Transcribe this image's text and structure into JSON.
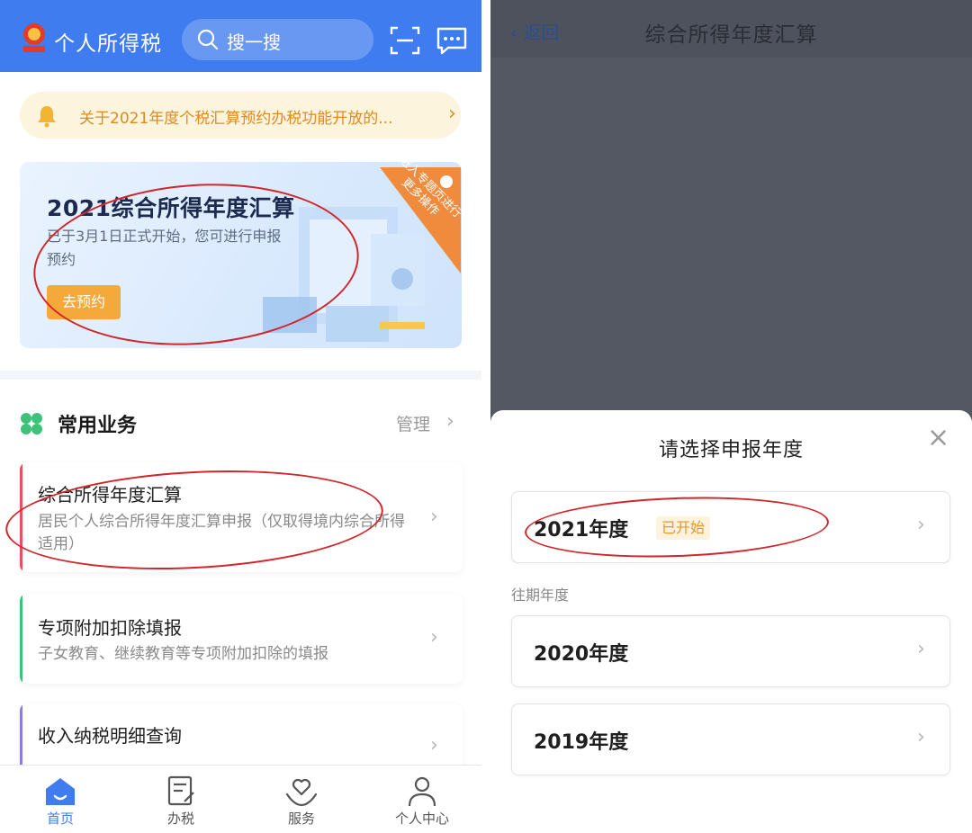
{
  "left": {
    "app_title": "个人所得税",
    "search_placeholder": "搜一搜",
    "notice": {
      "text": "关于2021年度个税汇算预约办税功能开放的..."
    },
    "banner": {
      "title": "2021综合所得年度汇算",
      "subtitle": "已于3月1日正式开始，您可进行申报预约",
      "button": "去预约",
      "ribbon": "进入专题页进行更多操作"
    },
    "section": {
      "title": "常用业务",
      "manage": "管理"
    },
    "cards": [
      {
        "title": "综合所得年度汇算",
        "subtitle": "居民个人综合所得年度汇算申报（仅取得境内综合所得适用）",
        "accent": "#e8525a"
      },
      {
        "title": "专项附加扣除填报",
        "subtitle": "子女教育、继续教育等专项附加扣除的填报",
        "accent": "#3ec27a"
      },
      {
        "title": "收入纳税明细查询",
        "subtitle": "",
        "accent": "#8a7fe0"
      }
    ],
    "tabs": [
      {
        "label": "首页",
        "icon": "home-icon",
        "active": true
      },
      {
        "label": "办税",
        "icon": "document-edit-icon",
        "active": false
      },
      {
        "label": "服务",
        "icon": "heart-hand-icon",
        "active": false
      },
      {
        "label": "个人中心",
        "icon": "person-icon",
        "active": false
      }
    ],
    "colors": {
      "brand": "#3f7cf0",
      "notice_text": "#e08a1e",
      "button": "#f6a93b"
    }
  },
  "right": {
    "back_label": "返回",
    "title": "综合所得年度汇算",
    "sheet": {
      "title": "请选择申报年度",
      "current_year": {
        "label": "2021年度",
        "badge": "已开始"
      },
      "past_label": "往期年度",
      "past_years": [
        {
          "label": "2020年度"
        },
        {
          "label": "2019年度"
        }
      ]
    }
  }
}
